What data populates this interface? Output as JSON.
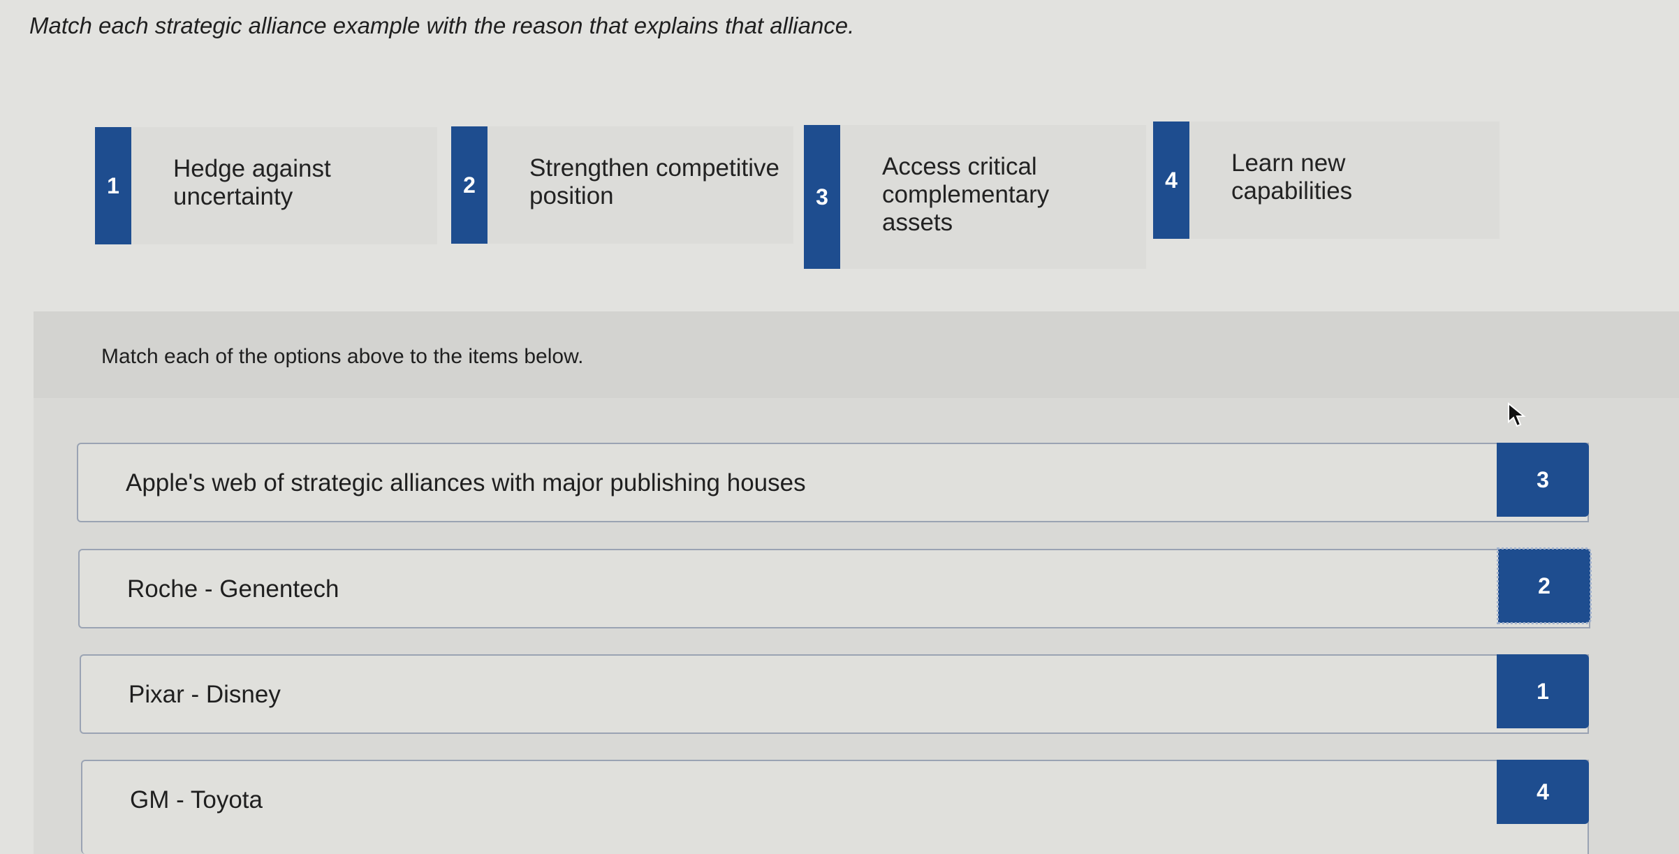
{
  "question": "Match each strategic alliance example with the reason that explains that alliance.",
  "options": [
    {
      "number": "1",
      "label": "Hedge against uncertainty"
    },
    {
      "number": "2",
      "label": "Strengthen competitive position"
    },
    {
      "number": "3",
      "label": "Access critical complementary assets"
    },
    {
      "number": "4",
      "label": "Learn new capabilities"
    }
  ],
  "instruction": "Match each of the options above to the items below.",
  "items": [
    {
      "label": "Apple's web of strategic alliances with major publishing houses",
      "answer": "3"
    },
    {
      "label": "Roche - Genentech",
      "answer": "2"
    },
    {
      "label": "Pixar - Disney",
      "answer": "1"
    },
    {
      "label": "GM - Toyota",
      "answer": "4"
    }
  ],
  "colors": {
    "accent": "#1e4d8f",
    "background": "#e2e2df"
  },
  "icons": {
    "cursor": "mouse-pointer-icon"
  }
}
